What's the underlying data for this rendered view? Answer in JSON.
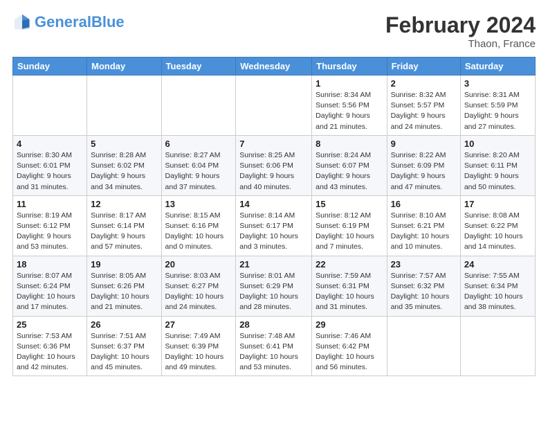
{
  "header": {
    "logo_general": "General",
    "logo_blue": "Blue",
    "month_title": "February 2024",
    "location": "Thaon, France"
  },
  "days_of_week": [
    "Sunday",
    "Monday",
    "Tuesday",
    "Wednesday",
    "Thursday",
    "Friday",
    "Saturday"
  ],
  "weeks": [
    [
      {
        "day": "",
        "info": ""
      },
      {
        "day": "",
        "info": ""
      },
      {
        "day": "",
        "info": ""
      },
      {
        "day": "",
        "info": ""
      },
      {
        "day": "1",
        "info": "Sunrise: 8:34 AM\nSunset: 5:56 PM\nDaylight: 9 hours\nand 21 minutes."
      },
      {
        "day": "2",
        "info": "Sunrise: 8:32 AM\nSunset: 5:57 PM\nDaylight: 9 hours\nand 24 minutes."
      },
      {
        "day": "3",
        "info": "Sunrise: 8:31 AM\nSunset: 5:59 PM\nDaylight: 9 hours\nand 27 minutes."
      }
    ],
    [
      {
        "day": "4",
        "info": "Sunrise: 8:30 AM\nSunset: 6:01 PM\nDaylight: 9 hours\nand 31 minutes."
      },
      {
        "day": "5",
        "info": "Sunrise: 8:28 AM\nSunset: 6:02 PM\nDaylight: 9 hours\nand 34 minutes."
      },
      {
        "day": "6",
        "info": "Sunrise: 8:27 AM\nSunset: 6:04 PM\nDaylight: 9 hours\nand 37 minutes."
      },
      {
        "day": "7",
        "info": "Sunrise: 8:25 AM\nSunset: 6:06 PM\nDaylight: 9 hours\nand 40 minutes."
      },
      {
        "day": "8",
        "info": "Sunrise: 8:24 AM\nSunset: 6:07 PM\nDaylight: 9 hours\nand 43 minutes."
      },
      {
        "day": "9",
        "info": "Sunrise: 8:22 AM\nSunset: 6:09 PM\nDaylight: 9 hours\nand 47 minutes."
      },
      {
        "day": "10",
        "info": "Sunrise: 8:20 AM\nSunset: 6:11 PM\nDaylight: 9 hours\nand 50 minutes."
      }
    ],
    [
      {
        "day": "11",
        "info": "Sunrise: 8:19 AM\nSunset: 6:12 PM\nDaylight: 9 hours\nand 53 minutes."
      },
      {
        "day": "12",
        "info": "Sunrise: 8:17 AM\nSunset: 6:14 PM\nDaylight: 9 hours\nand 57 minutes."
      },
      {
        "day": "13",
        "info": "Sunrise: 8:15 AM\nSunset: 6:16 PM\nDaylight: 10 hours\nand 0 minutes."
      },
      {
        "day": "14",
        "info": "Sunrise: 8:14 AM\nSunset: 6:17 PM\nDaylight: 10 hours\nand 3 minutes."
      },
      {
        "day": "15",
        "info": "Sunrise: 8:12 AM\nSunset: 6:19 PM\nDaylight: 10 hours\nand 7 minutes."
      },
      {
        "day": "16",
        "info": "Sunrise: 8:10 AM\nSunset: 6:21 PM\nDaylight: 10 hours\nand 10 minutes."
      },
      {
        "day": "17",
        "info": "Sunrise: 8:08 AM\nSunset: 6:22 PM\nDaylight: 10 hours\nand 14 minutes."
      }
    ],
    [
      {
        "day": "18",
        "info": "Sunrise: 8:07 AM\nSunset: 6:24 PM\nDaylight: 10 hours\nand 17 minutes."
      },
      {
        "day": "19",
        "info": "Sunrise: 8:05 AM\nSunset: 6:26 PM\nDaylight: 10 hours\nand 21 minutes."
      },
      {
        "day": "20",
        "info": "Sunrise: 8:03 AM\nSunset: 6:27 PM\nDaylight: 10 hours\nand 24 minutes."
      },
      {
        "day": "21",
        "info": "Sunrise: 8:01 AM\nSunset: 6:29 PM\nDaylight: 10 hours\nand 28 minutes."
      },
      {
        "day": "22",
        "info": "Sunrise: 7:59 AM\nSunset: 6:31 PM\nDaylight: 10 hours\nand 31 minutes."
      },
      {
        "day": "23",
        "info": "Sunrise: 7:57 AM\nSunset: 6:32 PM\nDaylight: 10 hours\nand 35 minutes."
      },
      {
        "day": "24",
        "info": "Sunrise: 7:55 AM\nSunset: 6:34 PM\nDaylight: 10 hours\nand 38 minutes."
      }
    ],
    [
      {
        "day": "25",
        "info": "Sunrise: 7:53 AM\nSunset: 6:36 PM\nDaylight: 10 hours\nand 42 minutes."
      },
      {
        "day": "26",
        "info": "Sunrise: 7:51 AM\nSunset: 6:37 PM\nDaylight: 10 hours\nand 45 minutes."
      },
      {
        "day": "27",
        "info": "Sunrise: 7:49 AM\nSunset: 6:39 PM\nDaylight: 10 hours\nand 49 minutes."
      },
      {
        "day": "28",
        "info": "Sunrise: 7:48 AM\nSunset: 6:41 PM\nDaylight: 10 hours\nand 53 minutes."
      },
      {
        "day": "29",
        "info": "Sunrise: 7:46 AM\nSunset: 6:42 PM\nDaylight: 10 hours\nand 56 minutes."
      },
      {
        "day": "",
        "info": ""
      },
      {
        "day": "",
        "info": ""
      }
    ]
  ]
}
